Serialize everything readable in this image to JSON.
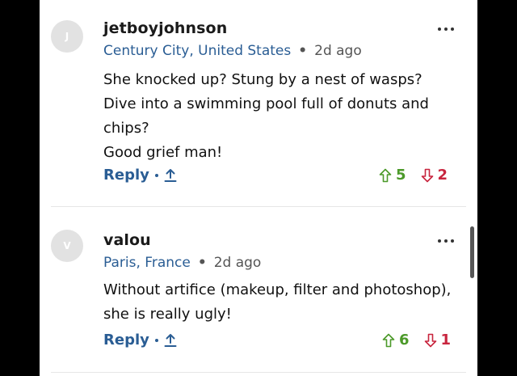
{
  "comments": [
    {
      "avatar_initial": "J",
      "username": "jetboyjohnson",
      "location": "Century City, United States",
      "separator": "•",
      "time_ago": "2d ago",
      "lines": [
        "She knocked up?  Stung by a nest of wasps?",
        "Dive into a swimming pool full of donuts and",
        "chips?",
        "Good grief man!"
      ],
      "reply_label": "Reply",
      "upvotes": "5",
      "downvotes": "2"
    },
    {
      "avatar_initial": "V",
      "username": "valou",
      "location": "Paris, France",
      "separator": "•",
      "time_ago": "2d ago",
      "lines": [
        "Without artifice (makeup, filter and photoshop),",
        "she is really ugly!"
      ],
      "reply_label": "Reply",
      "upvotes": "6",
      "downvotes": "1"
    }
  ],
  "colors": {
    "link_blue": "#2a5d94",
    "upvote_green": "#4c9a2a",
    "downvote_red": "#c8253e",
    "avatar_grey": "#e2e2e2"
  },
  "icons": [
    "more-options-icon",
    "share-icon",
    "upvote-arrow-icon",
    "downvote-arrow-icon"
  ]
}
